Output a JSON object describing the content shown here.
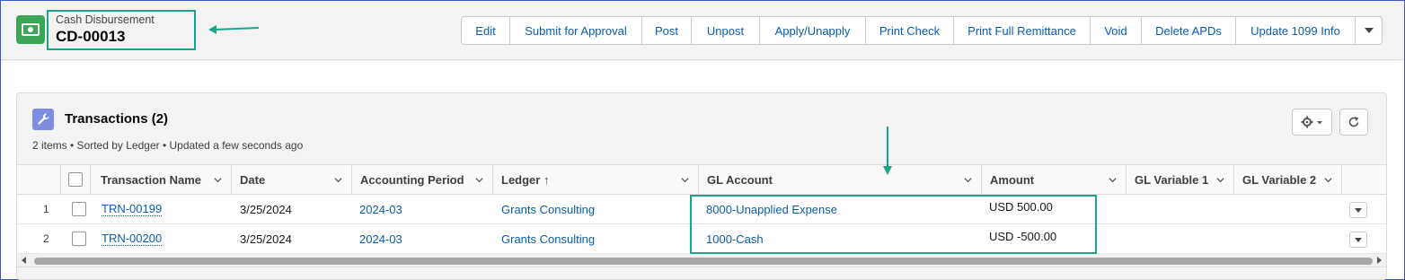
{
  "header": {
    "record_type": "Cash Disbursement",
    "record_name": "CD-00013",
    "actions": [
      "Edit",
      "Submit for Approval",
      "Post",
      "Unpost",
      "Apply/Unapply",
      "Print Check",
      "Print Full Remittance",
      "Void",
      "Delete APDs",
      "Update 1099 Info"
    ],
    "more_icon": "chevron-down-icon"
  },
  "card": {
    "icon": "wrench-icon",
    "title": "Transactions (2)",
    "subtitle": "2 items • Sorted by Ledger • Updated a few seconds ago",
    "tools": [
      "gear-icon",
      "refresh-icon"
    ]
  },
  "table": {
    "columns": [
      "Transaction Name",
      "Date",
      "Accounting Period",
      "Ledger ↑",
      "GL Account",
      "Amount",
      "GL Variable 1",
      "GL Variable 2"
    ],
    "rows": [
      {
        "num": "1",
        "name": "TRN-00199",
        "date": "3/25/2024",
        "period": "2024-03",
        "ledger": "Grants Consulting",
        "gl_account": "8000-Unapplied Expense",
        "amount": "USD 500.00"
      },
      {
        "num": "2",
        "name": "TRN-00200",
        "date": "3/25/2024",
        "period": "2024-03",
        "ledger": "Grants Consulting",
        "gl_account": "1000-Cash",
        "amount": "USD -500.00"
      }
    ]
  },
  "colors": {
    "highlight": "#1aa58a",
    "link": "#0b5cab",
    "record_icon": "#3ba755",
    "card_icon": "#7f8de1"
  }
}
